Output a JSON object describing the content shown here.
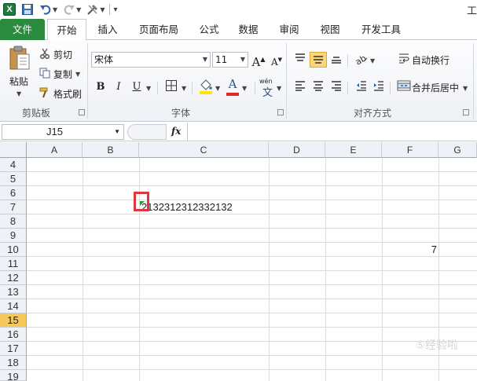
{
  "app": {
    "title_fragment": "工",
    "quick_access": [
      "excel-logo",
      "save-icon",
      "undo-icon",
      "redo-icon",
      "customize-icon"
    ]
  },
  "tabs": [
    {
      "label": "文件",
      "kind": "file"
    },
    {
      "label": "开始",
      "kind": "active"
    },
    {
      "label": "插入"
    },
    {
      "label": "页面布局"
    },
    {
      "label": "公式"
    },
    {
      "label": "数据"
    },
    {
      "label": "审阅"
    },
    {
      "label": "视图"
    },
    {
      "label": "开发工具"
    }
  ],
  "ribbon": {
    "clipboard": {
      "paste": "粘贴",
      "cut": "剪切",
      "copy": "复制",
      "format_painter": "格式刷",
      "group_label": "剪贴板"
    },
    "font": {
      "font_name": "宋体",
      "font_size": "11",
      "grow": "A",
      "shrink": "A",
      "bold": "B",
      "italic": "I",
      "underline": "U",
      "border_glyph": "田",
      "font_color_glyph": "A",
      "phonetic_glyph": "文",
      "phonetic_top": "wén",
      "group_label": "字体"
    },
    "alignment": {
      "wrap_text": "自动换行",
      "merge_center": "合并后居中",
      "group_label": "对齐方式"
    }
  },
  "formula_bar": {
    "name_box": "J15",
    "fx": "fx",
    "formula": ""
  },
  "sheet": {
    "columns": [
      "A",
      "B",
      "C",
      "D",
      "E",
      "F",
      "G"
    ],
    "rows": [
      "4",
      "5",
      "6",
      "7",
      "8",
      "9",
      "10",
      "11",
      "12",
      "13",
      "14",
      "15",
      "16",
      "17",
      "18",
      "19"
    ],
    "selected_row": "15",
    "cells": {
      "C7": "'2132312312332132",
      "C7_display": "2132312312332132",
      "F10": "7"
    }
  },
  "watermark": "⑤经验啦"
}
